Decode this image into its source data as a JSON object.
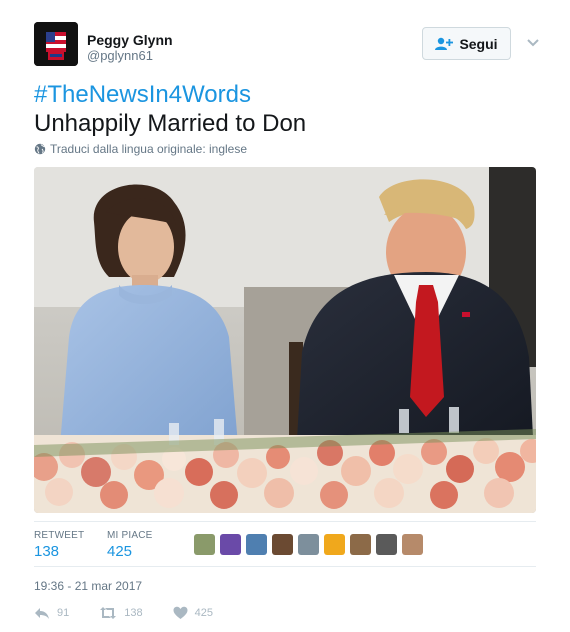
{
  "author": {
    "fullname": "Peggy Glynn",
    "screenname": "@pglynn61",
    "avatar_icon": "raised-fist-flag-icon"
  },
  "follow": {
    "label": "Segui",
    "icon": "add-user-icon"
  },
  "tweet": {
    "hashtag": "#TheNewsIn4Words",
    "text": "Unhappily Married to Don",
    "translate_label": "Traduci dalla lingua originale: inglese"
  },
  "stats": {
    "retweet_label": "RETWEET",
    "retweet_count": "138",
    "likes_label": "MI PIACE",
    "likes_count": "425"
  },
  "timestamp": "19:36 - 21 mar 2017",
  "actions": {
    "reply_count": "91",
    "retweet_count": "138",
    "like_count": "425"
  },
  "colors": {
    "accent": "#1b95e0",
    "muted": "#657786",
    "action": "#aab8c2"
  }
}
